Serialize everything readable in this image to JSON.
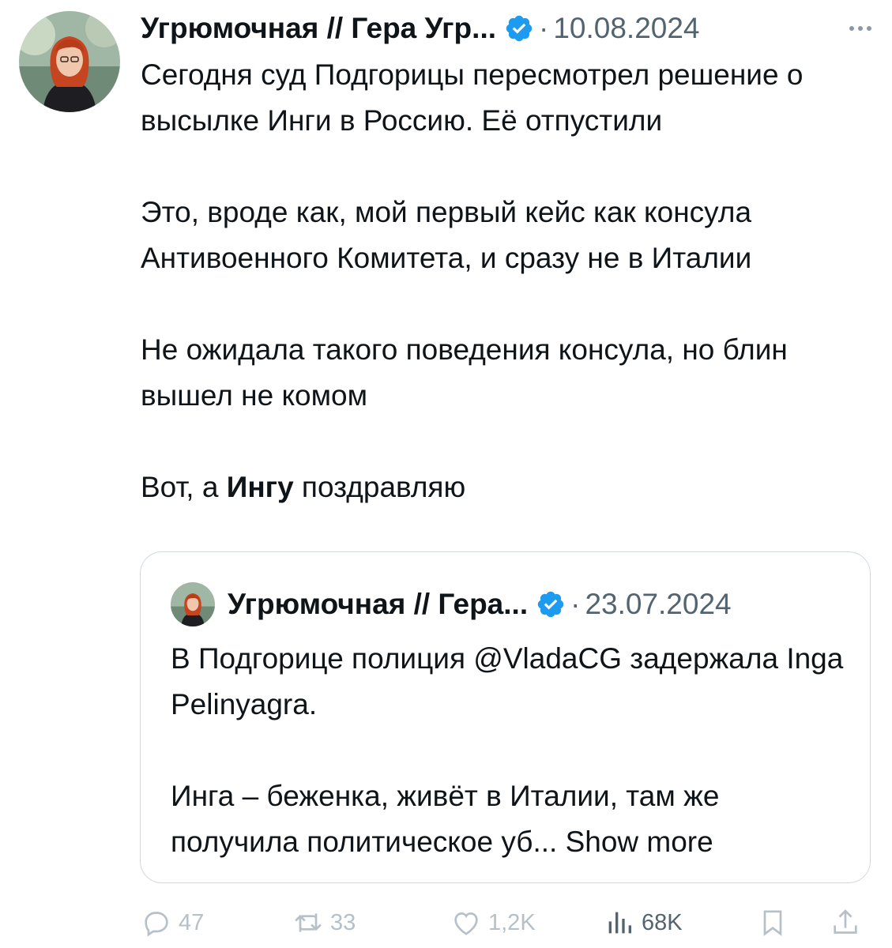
{
  "tweet": {
    "author_name": "Угрюмочная // Гера Угр...",
    "separator": "·",
    "date": "10.08.2024",
    "paragraphs": {
      "p1": "Сегодня суд Подгорицы пересмотрел решение о высылке Инги в Россию. Её отпустили",
      "p2": "Это, вроде как, мой первый кейс как консула Антивоенного Комитета, и сразу не в Италии",
      "p3": "Не ожидала такого поведения консула, но блин вышел не комом",
      "p4_start": "Вот, а ",
      "p4_bold": "Ингу",
      "p4_end": " поздравляю"
    }
  },
  "quoted_tweet": {
    "author_name": "Угрюмочная // Гера...",
    "separator": "·",
    "date": "23.07.2024",
    "p1_start": "В Подгорице полиция ",
    "p1_mention": "@VladaCG",
    "p1_end": " задержала Inga Pelinyagra.",
    "p2": "Инга – беженка, живёт в Италии, там же получила политическое уб...",
    "show_more": "Show more"
  },
  "actions": {
    "replies": "47",
    "reposts": "33",
    "likes": "1,2K",
    "views": "68K"
  },
  "icons": {
    "verified": "verified-badge-icon",
    "more": "more-options-icon",
    "reply": "reply-icon",
    "repost": "repost-icon",
    "like": "like-icon",
    "views": "views-icon",
    "bookmark": "bookmark-icon",
    "share": "share-icon"
  },
  "colors": {
    "verified_blue": "#1d9bf0",
    "text": "#0f1419",
    "secondary": "#536471",
    "faded_actions": "#b7c0c8",
    "border": "#cfd9de"
  }
}
